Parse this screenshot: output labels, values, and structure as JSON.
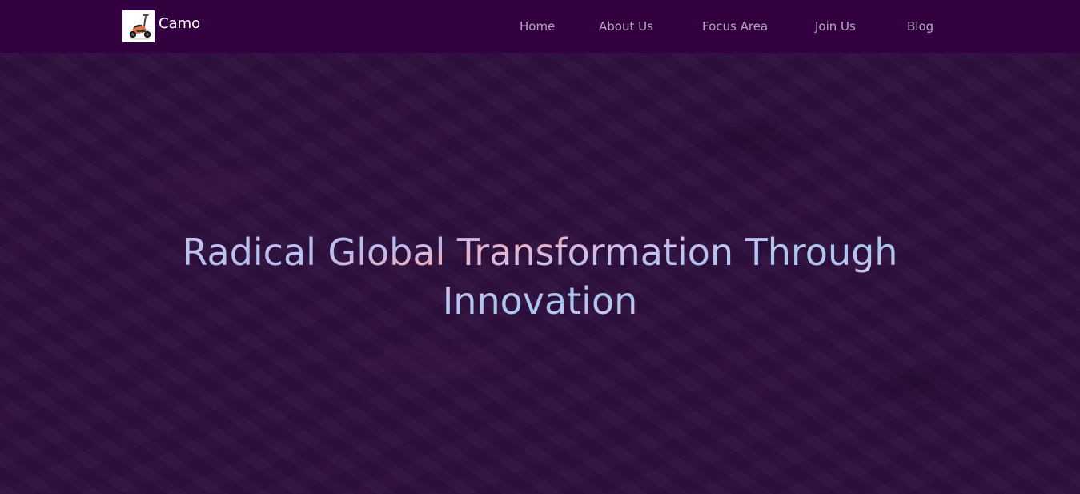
{
  "brand": {
    "name": "Camo",
    "logo_icon": "scooter-icon"
  },
  "nav": {
    "items": [
      {
        "label": "Home"
      },
      {
        "label": "About Us"
      },
      {
        "label": "Focus Area"
      },
      {
        "label": "Join Us"
      },
      {
        "label": "Blog"
      }
    ]
  },
  "hero": {
    "title_line1": "Radical Global Transformation Through",
    "title_line2": "Innovation"
  },
  "colors": {
    "navbar_bg": "#330040",
    "hero_bg": "#2f0f3e",
    "nav_text": "#b7a5c1",
    "brand_text": "#ffffff"
  }
}
